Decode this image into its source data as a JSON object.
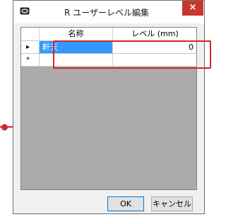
{
  "window": {
    "title": "R ユーザーレベル編集",
    "close_glyph": "×"
  },
  "grid": {
    "columns": [
      "名称",
      "レベル (mm)"
    ],
    "rows": [
      {
        "marker": "▸",
        "name": "軒天",
        "level": "0",
        "selected": true
      },
      {
        "marker": "*",
        "name": "",
        "level": "",
        "selected": false
      }
    ]
  },
  "buttons": {
    "ok": "OK",
    "cancel": "キャンセル"
  },
  "colors": {
    "selection": "#3399ff",
    "highlight": "#d0262c",
    "close": "#c7372f"
  }
}
